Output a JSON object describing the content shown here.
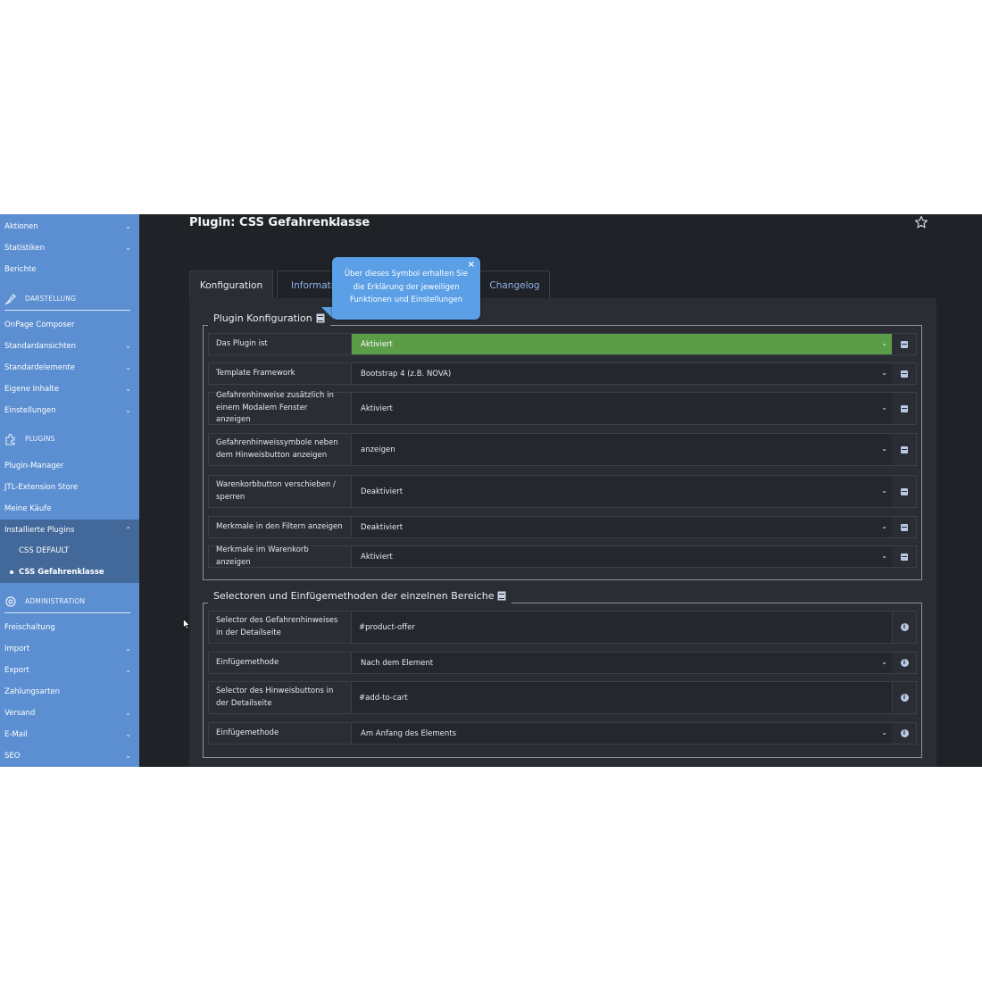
{
  "sidebar": {
    "items_top": [
      {
        "label": "Aktionen",
        "chevron": true
      },
      {
        "label": "Statistiken",
        "chevron": true
      },
      {
        "label": "Berichte",
        "chevron": false
      }
    ],
    "section_darstellung": "DARSTELLUNG",
    "items_darstellung": [
      {
        "label": "OnPage Composer",
        "chevron": false
      },
      {
        "label": "Standardansichten",
        "chevron": true
      },
      {
        "label": "Standardelemente",
        "chevron": true
      },
      {
        "label": "Eigene Inhalte",
        "chevron": true
      },
      {
        "label": "Einstellungen",
        "chevron": true
      }
    ],
    "section_plugins": "PLUGINS",
    "items_plugins": [
      {
        "label": "Plugin-Manager"
      },
      {
        "label": "JTL-Extension Store"
      },
      {
        "label": "Meine Käufe"
      },
      {
        "label": "Installierte Plugins"
      }
    ],
    "sub_items": [
      {
        "label": "CSS DEFAULT"
      },
      {
        "label": "CSS Gefahrenklasse"
      }
    ],
    "section_administration": "ADMINISTRATION",
    "items_administration": [
      {
        "label": "Freischaltung"
      },
      {
        "label": "Import"
      },
      {
        "label": "Export"
      },
      {
        "label": "Zahlungsarten"
      },
      {
        "label": "Versand"
      },
      {
        "label": "E-Mail"
      },
      {
        "label": "SEO"
      }
    ]
  },
  "header": {
    "title": "Plugin: CSS Gefahrenklasse"
  },
  "tabs": {
    "konfiguration": "Konfiguration",
    "information": "Information",
    "changelog": "Changelog"
  },
  "tooltip": {
    "text": "Über dieses Symbol erhalten Sie die Erklärung der jeweiligen Funktionen und Einstellungen",
    "close": "×"
  },
  "section1": {
    "legend": "Plugin Konfiguration",
    "rows": [
      {
        "label": "Das Plugin ist",
        "value": "Aktiviert"
      },
      {
        "label": "Template Framework",
        "value": "Bootstrap 4 (z.B. NOVA)"
      },
      {
        "label": "Gefahrenhinweise zusätzlich in einem Modalem Fenster anzeigen",
        "value": "Aktiviert"
      },
      {
        "label": "Gefahrenhinweissymbole neben dem Hinweisbutton anzeigen",
        "value": "anzeigen"
      },
      {
        "label": "Warenkorbbutton verschieben / sperren",
        "value": "Deaktiviert"
      },
      {
        "label": "Merkmale in den Filtern anzeigen",
        "value": "Deaktiviert"
      },
      {
        "label": "Merkmale im Warenkorb anzeigen",
        "value": "Aktiviert"
      }
    ]
  },
  "section2": {
    "legend": "Selectoren und Einfügemethoden der einzelnen Bereiche",
    "rows": [
      {
        "label": "Selector des Gefahrenhinweises in der Detailseite",
        "value": "#product-offer"
      },
      {
        "label": "Einfügemethode",
        "value": "Nach dem Element"
      },
      {
        "label": "Selector des Hinweisbuttons in der Detailseite",
        "value": "#add-to-cart"
      },
      {
        "label": "Einfügemethode",
        "value": "Am Anfang des Elements"
      }
    ]
  },
  "colors": {
    "sidebar": "#5b8fd1",
    "sidebar_active": "#42699a",
    "background": "#1f2227",
    "panel": "#2a2e34",
    "green_select": "#5a9c47",
    "tooltip": "#5b9fe6"
  }
}
